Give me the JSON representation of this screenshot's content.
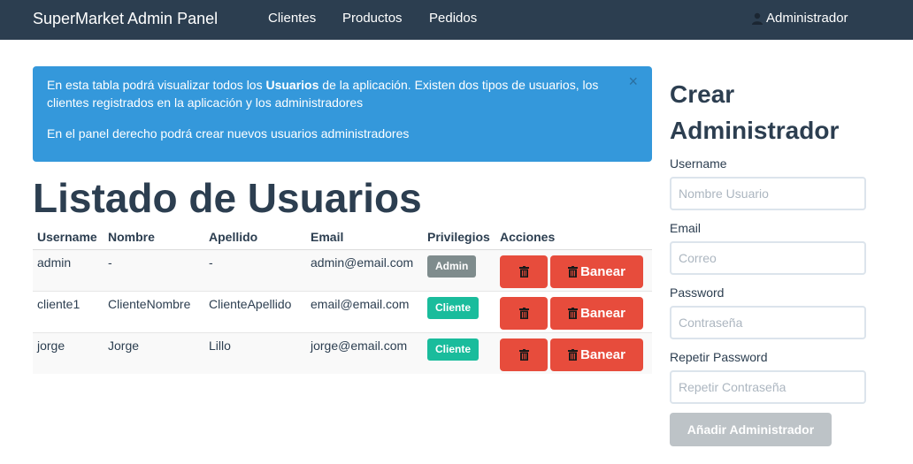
{
  "navbar": {
    "brand": "SuperMarket Admin Panel",
    "links": [
      "Clientes",
      "Productos",
      "Pedidos"
    ],
    "user": "Administrador"
  },
  "alert": {
    "line1_pre": "En esta tabla podrá visualizar todos los ",
    "line1_bold": "Usuarios",
    "line1_post": " de la aplicación. Existen dos tipos de usuarios, los clientes registrados en la aplicación y los administradores",
    "line2": "En el panel derecho podrá crear nuevos usuarios administradores",
    "close": "×"
  },
  "page_title": "Listado de Usuarios",
  "table": {
    "headers": [
      "Username",
      "Nombre",
      "Apellido",
      "Email",
      "Privilegios",
      "Acciones"
    ],
    "rows": [
      {
        "username": "admin",
        "nombre": "-",
        "apellido": "-",
        "email": "admin@email.com",
        "privilegio": "Admin"
      },
      {
        "username": "cliente1",
        "nombre": "ClienteNombre",
        "apellido": "ClienteApellido",
        "email": "email@email.com",
        "privilegio": "Cliente"
      },
      {
        "username": "jorge",
        "nombre": "Jorge",
        "apellido": "Lillo",
        "email": "jorge@email.com",
        "privilegio": "Cliente"
      }
    ],
    "ban_label": "Banear"
  },
  "form": {
    "title_line1": "Crear",
    "title_line2": "Administrador",
    "username_label": "Username",
    "username_placeholder": "Nombre Usuario",
    "email_label": "Email",
    "email_placeholder": "Correo",
    "password_label": "Password",
    "password_placeholder": "Contraseña",
    "repeat_label": "Repetir Password",
    "repeat_placeholder": "Repetir Contraseña",
    "submit_label": "Añadir Administrador"
  },
  "colors": {
    "navbar": "#2c3e50",
    "info": "#3498db",
    "danger": "#e74c3c",
    "success": "#1abc9c",
    "default": "#7f8c8d",
    "disabled": "#bdc3c7"
  }
}
